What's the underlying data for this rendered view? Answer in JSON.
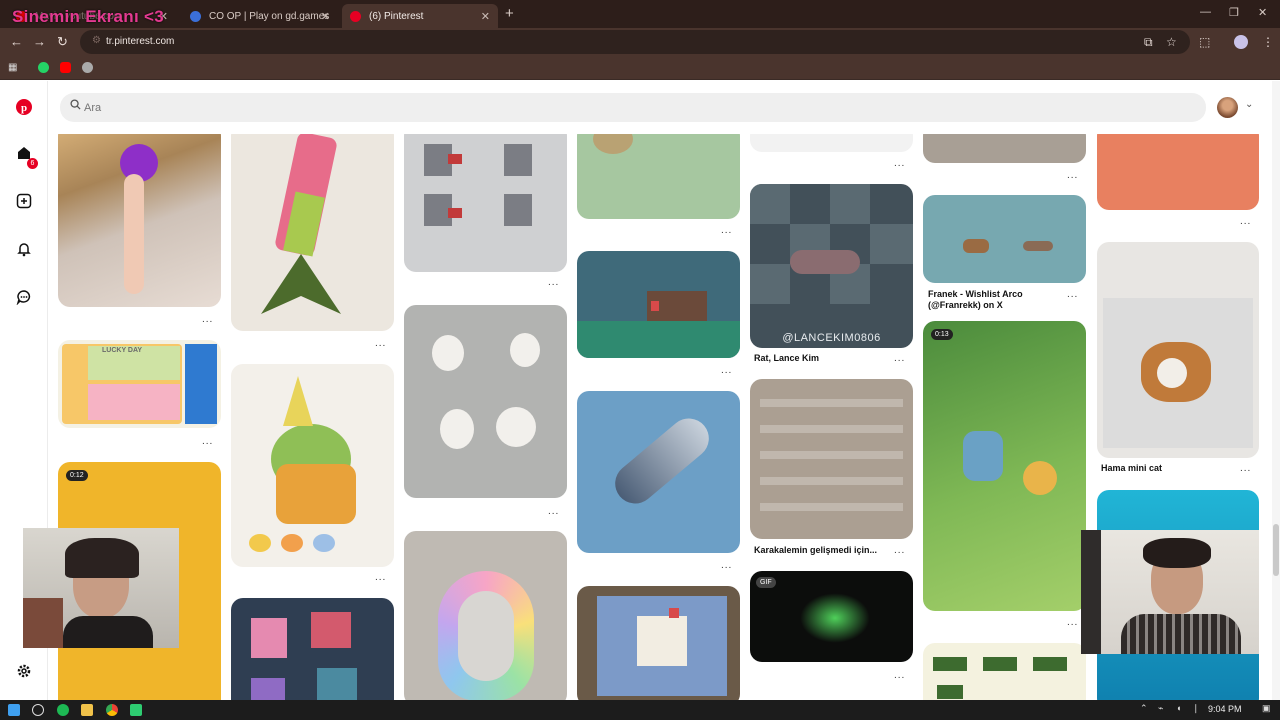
{
  "browser": {
    "tabs": [
      {
        "title": "Mavi - youtube.com"
      },
      {
        "title": "CO OP | Play on gd.games"
      },
      {
        "title": "(6) Pinterest"
      }
    ],
    "url": "tr.pinterest.com",
    "overlay_title": "Sinemin Ekranı <3"
  },
  "pinterest": {
    "search_placeholder": "Ara",
    "notifications_count": "6",
    "pins": {
      "franek_caption": "Franek - Wishlist Arco (@Franrekk) on X",
      "rat_watermark": "@LANCEKIM0806",
      "rat_caption": "Rat, Lance Kim",
      "karakalem_caption": "Karakalemin gelişmedi için...",
      "hama_caption": "Hama mini cat",
      "lucky_day": "LUCKY DAY",
      "duration_1": "0:12",
      "duration_2": "0:13",
      "gif_badge": "GIF",
      "more": "..."
    }
  },
  "taskbar": {
    "time": "9:04 PM"
  },
  "icons": {
    "pinterest_logo": "pinterest-logo-icon",
    "home": "home-icon",
    "create": "plus-square-icon",
    "notifications": "bell-icon",
    "messages": "chat-icon",
    "settings": "gear-icon",
    "search": "search-icon"
  },
  "colors": {
    "brand": "#e60023",
    "overlay_pink": "#e43a91",
    "chrome_dark": "#2d1e1a",
    "chrome": "#4a342d"
  }
}
